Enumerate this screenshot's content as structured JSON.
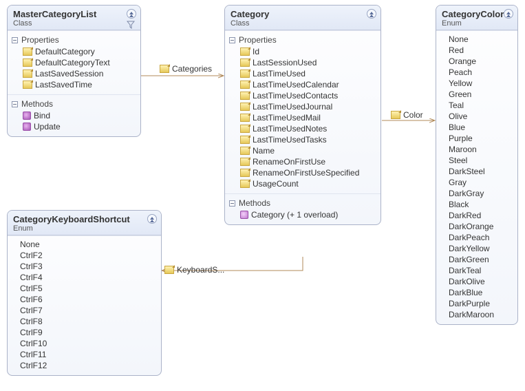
{
  "boxes": {
    "masterCategoryList": {
      "title": "MasterCategoryList",
      "subtitle": "Class",
      "sections": {
        "properties": {
          "label": "Properties",
          "items": [
            "DefaultCategory",
            "DefaultCategoryText",
            "LastSavedSession",
            "LastSavedTime"
          ]
        },
        "methods": {
          "label": "Methods",
          "items": [
            "Bind",
            "Update"
          ]
        }
      }
    },
    "category": {
      "title": "Category",
      "subtitle": "Class",
      "sections": {
        "properties": {
          "label": "Properties",
          "items": [
            "Id",
            "LastSessionUsed",
            "LastTimeUsed",
            "LastTimeUsedCalendar",
            "LastTimeUsedContacts",
            "LastTimeUsedJournal",
            "LastTimeUsedMail",
            "LastTimeUsedNotes",
            "LastTimeUsedTasks",
            "Name",
            "RenameOnFirstUse",
            "RenameOnFirstUseSpecified",
            "UsageCount"
          ]
        },
        "methods": {
          "label": "Methods",
          "items": [
            "Category (+ 1 overload)"
          ]
        }
      }
    },
    "categoryKeyboardShortcut": {
      "title": "CategoryKeyboardShortcut",
      "subtitle": "Enum",
      "items": [
        "None",
        "CtrlF2",
        "CtrlF3",
        "CtrlF4",
        "CtrlF5",
        "CtrlF6",
        "CtrlF7",
        "CtrlF8",
        "CtrlF9",
        "CtrlF10",
        "CtrlF11",
        "CtrlF12"
      ]
    },
    "categoryColor": {
      "title": "CategoryColor",
      "subtitle": "Enum",
      "items": [
        "None",
        "Red",
        "Orange",
        "Peach",
        "Yellow",
        "Green",
        "Teal",
        "Olive",
        "Blue",
        "Purple",
        "Maroon",
        "Steel",
        "DarkSteel",
        "Gray",
        "DarkGray",
        "Black",
        "DarkRed",
        "DarkOrange",
        "DarkPeach",
        "DarkYellow",
        "DarkGreen",
        "DarkTeal",
        "DarkOlive",
        "DarkBlue",
        "DarkPurple",
        "DarkMaroon"
      ]
    }
  },
  "connectors": {
    "categories": "Categories",
    "color": "Color",
    "keyboardShortcut": "KeyboardS..."
  },
  "chart_data": {
    "type": "class-diagram",
    "entities": [
      {
        "name": "MasterCategoryList",
        "kind": "Class",
        "properties": [
          "DefaultCategory",
          "DefaultCategoryText",
          "LastSavedSession",
          "LastSavedTime"
        ],
        "methods": [
          "Bind",
          "Update"
        ]
      },
      {
        "name": "Category",
        "kind": "Class",
        "properties": [
          "Id",
          "LastSessionUsed",
          "LastTimeUsed",
          "LastTimeUsedCalendar",
          "LastTimeUsedContacts",
          "LastTimeUsedJournal",
          "LastTimeUsedMail",
          "LastTimeUsedNotes",
          "LastTimeUsedTasks",
          "Name",
          "RenameOnFirstUse",
          "RenameOnFirstUseSpecified",
          "UsageCount"
        ],
        "methods": [
          "Category (+ 1 overload)"
        ]
      },
      {
        "name": "CategoryKeyboardShortcut",
        "kind": "Enum",
        "values": [
          "None",
          "CtrlF2",
          "CtrlF3",
          "CtrlF4",
          "CtrlF5",
          "CtrlF6",
          "CtrlF7",
          "CtrlF8",
          "CtrlF9",
          "CtrlF10",
          "CtrlF11",
          "CtrlF12"
        ]
      },
      {
        "name": "CategoryColor",
        "kind": "Enum",
        "values": [
          "None",
          "Red",
          "Orange",
          "Peach",
          "Yellow",
          "Green",
          "Teal",
          "Olive",
          "Blue",
          "Purple",
          "Maroon",
          "Steel",
          "DarkSteel",
          "Gray",
          "DarkGray",
          "Black",
          "DarkRed",
          "DarkOrange",
          "DarkPeach",
          "DarkYellow",
          "DarkGreen",
          "DarkTeal",
          "DarkOlive",
          "DarkBlue",
          "DarkPurple",
          "DarkMaroon"
        ]
      }
    ],
    "associations": [
      {
        "from": "MasterCategoryList",
        "to": "Category",
        "label": "Categories"
      },
      {
        "from": "Category",
        "to": "CategoryColor",
        "label": "Color"
      },
      {
        "from": "Category",
        "to": "CategoryKeyboardShortcut",
        "label": "KeyboardShortcut"
      }
    ]
  }
}
